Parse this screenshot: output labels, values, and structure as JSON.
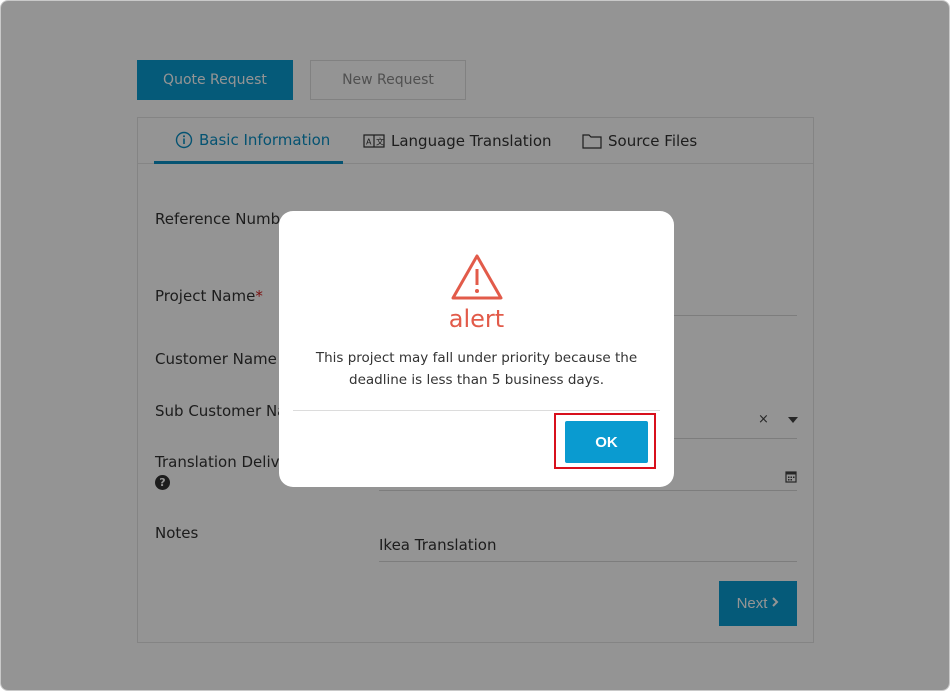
{
  "page_tabs": {
    "quote_request": "Quote Request",
    "new_request": "New Request"
  },
  "section_tabs": {
    "basic_information": "Basic Information",
    "language_translation": "Language Translation",
    "source_files": "Source Files"
  },
  "form": {
    "reference_number_label": "Reference Numbe",
    "project_name_label": "Project Name",
    "required_mark": "*",
    "customer_name_label": "Customer Name",
    "sub_customer_name_label": "Sub Customer Na",
    "translation_delivery_label": "Translation Delive",
    "notes_label": "Notes",
    "notes_value": "Ikea Translation",
    "clear_symbol": "×",
    "help_symbol": "?",
    "next_label": "Next"
  },
  "modal": {
    "title": "alert",
    "message": "This project may fall under priority because the deadline is less than 5 business days.",
    "ok_label": "OK"
  },
  "colors": {
    "accent": "#0a9bd0",
    "alert": "#e25b4a",
    "highlight": "#d8101c"
  },
  "icons": {
    "basic_information": "info-icon",
    "language_translation": "translate-icon",
    "source_files": "folder-icon",
    "modal": "warning-triangle-icon",
    "date_field": "calendar-icon",
    "next": "chevron-right-icon"
  }
}
